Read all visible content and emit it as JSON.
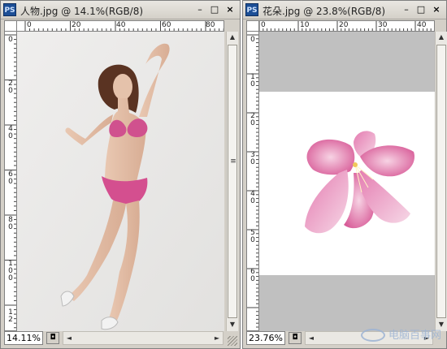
{
  "windows": [
    {
      "app_icon": "PS",
      "title": "人物.jpg @ 14.1%(RGB/8)",
      "zoom": "14.11%",
      "h_ticks": [
        "0",
        "20",
        "40",
        "60",
        "80"
      ],
      "v_ticks": [
        [
          "0"
        ],
        [
          "2",
          "0"
        ],
        [
          "4",
          "0"
        ],
        [
          "6",
          "0"
        ],
        [
          "8",
          "0"
        ],
        [
          "1",
          "0",
          "0"
        ],
        [
          "1",
          "2"
        ]
      ]
    },
    {
      "app_icon": "PS",
      "title": "花朵.jpg @ 23.8%(RGB/8)",
      "zoom": "23.76%",
      "h_ticks": [
        "0",
        "10",
        "20",
        "30",
        "40"
      ],
      "v_ticks": [
        [
          "0"
        ],
        [
          "1",
          "0"
        ],
        [
          "2",
          "0"
        ],
        [
          "3",
          "0"
        ],
        [
          "4",
          "0"
        ],
        [
          "5",
          "0"
        ],
        [
          "6",
          "0"
        ]
      ]
    }
  ],
  "buttons": {
    "minimize": "–",
    "maximize": "□",
    "close": "×"
  },
  "icons": {
    "up": "▲",
    "down": "▼",
    "left": "◄",
    "right": "►",
    "status_menu": "◘",
    "grip": "≡"
  },
  "watermark": "电脑百事网"
}
